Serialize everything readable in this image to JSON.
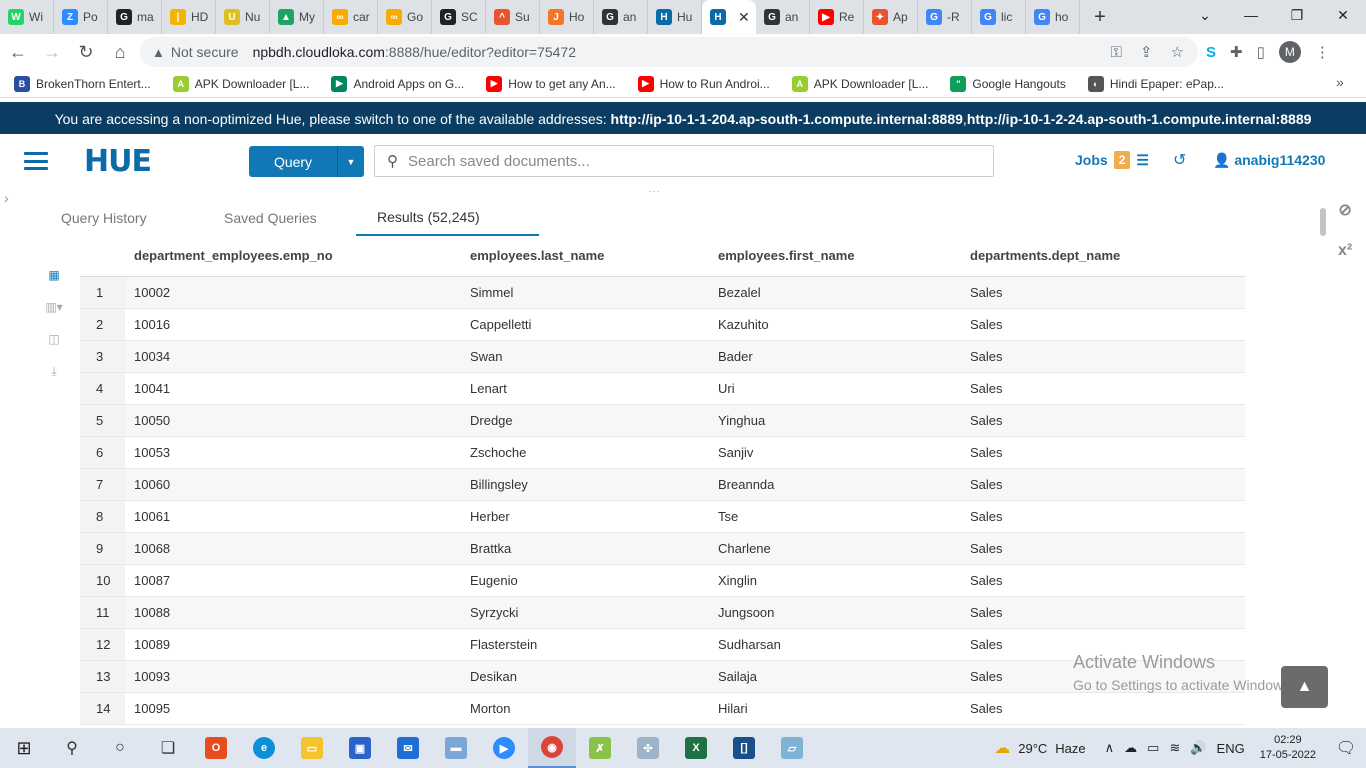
{
  "browser": {
    "tabs": [
      {
        "label": "Wi",
        "icon": "whatsapp-icon",
        "color": "#25d366",
        "glyph": "W"
      },
      {
        "label": "Po",
        "icon": "zoom-icon",
        "color": "#2d8cff",
        "glyph": "Z"
      },
      {
        "label": "ma",
        "icon": "github-icon",
        "color": "#222222",
        "glyph": "G"
      },
      {
        "label": "HD",
        "icon": "bar-icon",
        "color": "#f5b400",
        "glyph": "|"
      },
      {
        "label": "Nu",
        "icon": "shield-icon",
        "color": "#e0c020",
        "glyph": "U"
      },
      {
        "label": "My",
        "icon": "drive-icon",
        "color": "#1fa463",
        "glyph": "▲"
      },
      {
        "label": "car",
        "icon": "colab-icon",
        "color": "#f9ab00",
        "glyph": "∞"
      },
      {
        "label": "Go",
        "icon": "colab-icon",
        "color": "#f9ab00",
        "glyph": "∞"
      },
      {
        "label": "SC",
        "icon": "github-icon",
        "color": "#222222",
        "glyph": "G"
      },
      {
        "label": "Su",
        "icon": "arc-icon",
        "color": "#e8542e",
        "glyph": "^"
      },
      {
        "label": "Ho",
        "icon": "jupyter-icon",
        "color": "#f37726",
        "glyph": "J"
      },
      {
        "label": "an",
        "icon": "g-icon",
        "color": "#333333",
        "glyph": "G"
      },
      {
        "label": "Hu",
        "icon": "hue-icon",
        "color": "#0b6aa8",
        "glyph": "H"
      },
      {
        "label": "",
        "icon": "hue-icon",
        "color": "#0b6aa8",
        "glyph": "H",
        "active": true
      },
      {
        "label": "an",
        "icon": "g-icon",
        "color": "#333333",
        "glyph": "G"
      },
      {
        "label": "Re",
        "icon": "youtube-icon",
        "color": "#ff0000",
        "glyph": "▶"
      },
      {
        "label": "Ap",
        "icon": "star-icon",
        "color": "#e8542e",
        "glyph": "✦"
      },
      {
        "label": "-R",
        "icon": "google-icon",
        "color": "#4285f4",
        "glyph": "G"
      },
      {
        "label": "lic",
        "icon": "google-icon",
        "color": "#4285f4",
        "glyph": "G"
      },
      {
        "label": "ho",
        "icon": "google-icon",
        "color": "#4285f4",
        "glyph": "G"
      }
    ],
    "not_secure": "Not secure",
    "url_host": "npbdh.cloudloka.com",
    "url_path": ":8888/hue/editor?editor=75472",
    "bookmarks": [
      {
        "label": "BrokenThorn Entert...",
        "color": "#2a4fa0",
        "glyph": "B"
      },
      {
        "label": "APK Downloader [L...",
        "color": "#9acd32",
        "glyph": "A"
      },
      {
        "label": "Android Apps on G...",
        "color": "#01875f",
        "glyph": "▶"
      },
      {
        "label": "How to get any An...",
        "color": "#ff0000",
        "glyph": "▶"
      },
      {
        "label": "How to Run Androi...",
        "color": "#ff0000",
        "glyph": "▶"
      },
      {
        "label": "APK Downloader [L...",
        "color": "#9acd32",
        "glyph": "A"
      },
      {
        "label": "Google Hangouts",
        "color": "#0f9d58",
        "glyph": "\""
      },
      {
        "label": "Hindi Epaper: ePap...",
        "color": "#555555",
        "glyph": "◐"
      }
    ],
    "profile_initial": "M"
  },
  "banner": {
    "text": "You are accessing a non-optimized Hue, please switch to one of the available addresses: ",
    "addr1": "http://ip-10-1-1-204.ap-south-1.compute.internal:8889",
    "sep": ", ",
    "addr2": "http://ip-10-1-2-24.ap-south-1.compute.internal:8889"
  },
  "hue": {
    "logo": "HUE",
    "query_label": "Query",
    "search_placeholder": "Search saved documents...",
    "jobs_label": "Jobs",
    "jobs_count": "2",
    "username": "anabig114230"
  },
  "result_tabs": {
    "history": "Query History",
    "saved": "Saved Queries",
    "results": "Results (52,245)"
  },
  "table": {
    "headers": [
      "department_employees.emp_no",
      "employees.last_name",
      "employees.first_name",
      "departments.dept_name"
    ],
    "rows": [
      [
        "1",
        "10002",
        "Simmel",
        "Bezalel",
        "Sales"
      ],
      [
        "2",
        "10016",
        "Cappelletti",
        "Kazuhito",
        "Sales"
      ],
      [
        "3",
        "10034",
        "Swan",
        "Bader",
        "Sales"
      ],
      [
        "4",
        "10041",
        "Lenart",
        "Uri",
        "Sales"
      ],
      [
        "5",
        "10050",
        "Dredge",
        "Yinghua",
        "Sales"
      ],
      [
        "6",
        "10053",
        "Zschoche",
        "Sanjiv",
        "Sales"
      ],
      [
        "7",
        "10060",
        "Billingsley",
        "Breannda",
        "Sales"
      ],
      [
        "8",
        "10061",
        "Herber",
        "Tse",
        "Sales"
      ],
      [
        "9",
        "10068",
        "Brattka",
        "Charlene",
        "Sales"
      ],
      [
        "10",
        "10087",
        "Eugenio",
        "Xinglin",
        "Sales"
      ],
      [
        "11",
        "10088",
        "Syrzycki",
        "Jungsoon",
        "Sales"
      ],
      [
        "12",
        "10089",
        "Flasterstein",
        "Sudharsan",
        "Sales"
      ],
      [
        "13",
        "10093",
        "Desikan",
        "Sailaja",
        "Sales"
      ],
      [
        "14",
        "10095",
        "Morton",
        "Hilari",
        "Sales"
      ]
    ]
  },
  "watermark": {
    "line1": "Activate Windows",
    "line2": "Go to Settings to activate Windows."
  },
  "taskbar": {
    "temperature": "29°C",
    "weather": "Haze",
    "language": "ENG",
    "time": "02:29",
    "date": "17-05-2022"
  }
}
